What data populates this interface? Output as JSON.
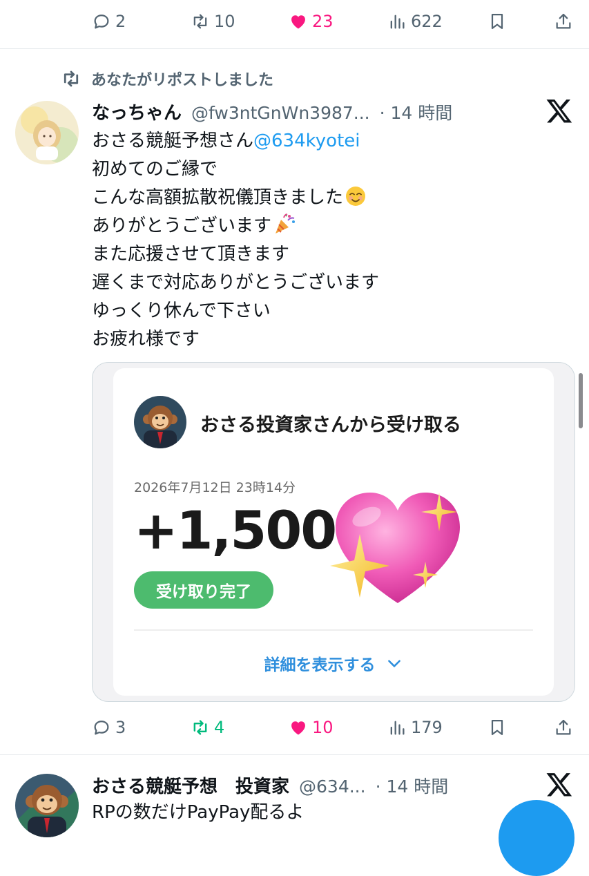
{
  "top_actions": {
    "replies": "2",
    "reposts": "10",
    "likes": "23",
    "views": "622"
  },
  "repost_indicator": "あなたがリポストしました",
  "tweet1": {
    "display_name": "なっちゃん",
    "handle": "@fw3ntGnWn3987...",
    "time": "· 14 時間",
    "text_lines": {
      "l1_prefix": "おさる競艇予想さん",
      "l1_mention": "@634kyotei",
      "l2": "初めてのご縁で",
      "l3": "こんな高額拡散祝儀頂きました",
      "l4": "ありがとうございます",
      "l5": "また応援させて頂きます",
      "l6": "遅くまで対応ありがとうございます",
      "l7": "ゆっくり休んで下さい",
      "l8": "お疲れ様です"
    },
    "card": {
      "title": "おさる投資家さんから受け取る",
      "date": "2026年7月12日 23時14分",
      "amount": "+1,500",
      "status_pill": "受け取り完了",
      "details_link": "詳細を表示する"
    },
    "actions": {
      "replies": "3",
      "reposts": "4",
      "likes": "10",
      "views": "179"
    }
  },
  "tweet2": {
    "display_name": "おさる競艇予想　投資家",
    "handle": "@634...",
    "time": "· 14 時間",
    "text": "RPの数だけPayPay配るよ"
  },
  "colors": {
    "accent_blue": "#1d9bf0",
    "like_pink": "#f91880",
    "repost_green": "#00ba7c",
    "muted_gray": "#536471",
    "pill_green": "#4dbb6e"
  },
  "icons": [
    "reply-icon",
    "repost-icon",
    "like-icon",
    "views-icon",
    "bookmark-icon",
    "share-icon",
    "x-logo-icon",
    "chevron-down-icon"
  ]
}
